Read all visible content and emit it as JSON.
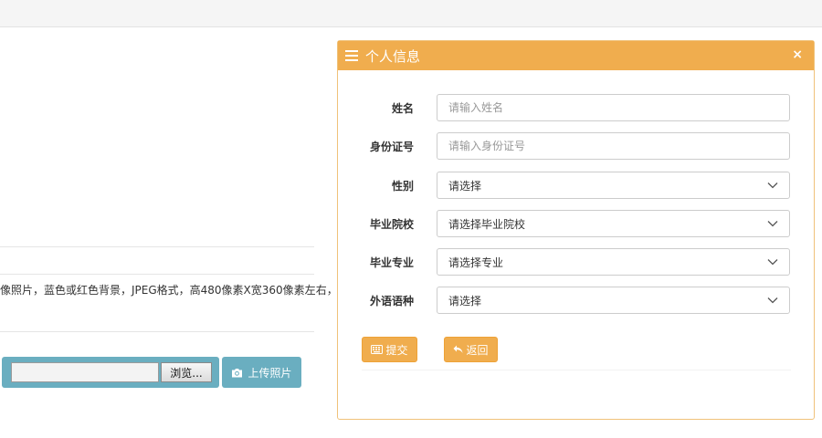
{
  "background": {
    "note": "像照片，蓝色或红色背景，JPEG格式，高480像素X宽360像素左右，",
    "browse_label": "浏览...",
    "upload_label": "上传照片"
  },
  "modal": {
    "title": "个人信息",
    "close_glyph": "×",
    "fields": {
      "name": {
        "label": "姓名",
        "placeholder": "请输入姓名"
      },
      "id_number": {
        "label": "身份证号",
        "placeholder": "请输入身份证号"
      },
      "gender": {
        "label": "性别",
        "value": "请选择"
      },
      "school": {
        "label": "毕业院校",
        "value": "请选择毕业院校"
      },
      "major": {
        "label": "毕业专业",
        "value": "请选择专业"
      },
      "language": {
        "label": "外语语种",
        "value": "请选择"
      }
    },
    "submit_label": "提交",
    "back_label": "返回",
    "accent_color": "#f0ad4e"
  }
}
